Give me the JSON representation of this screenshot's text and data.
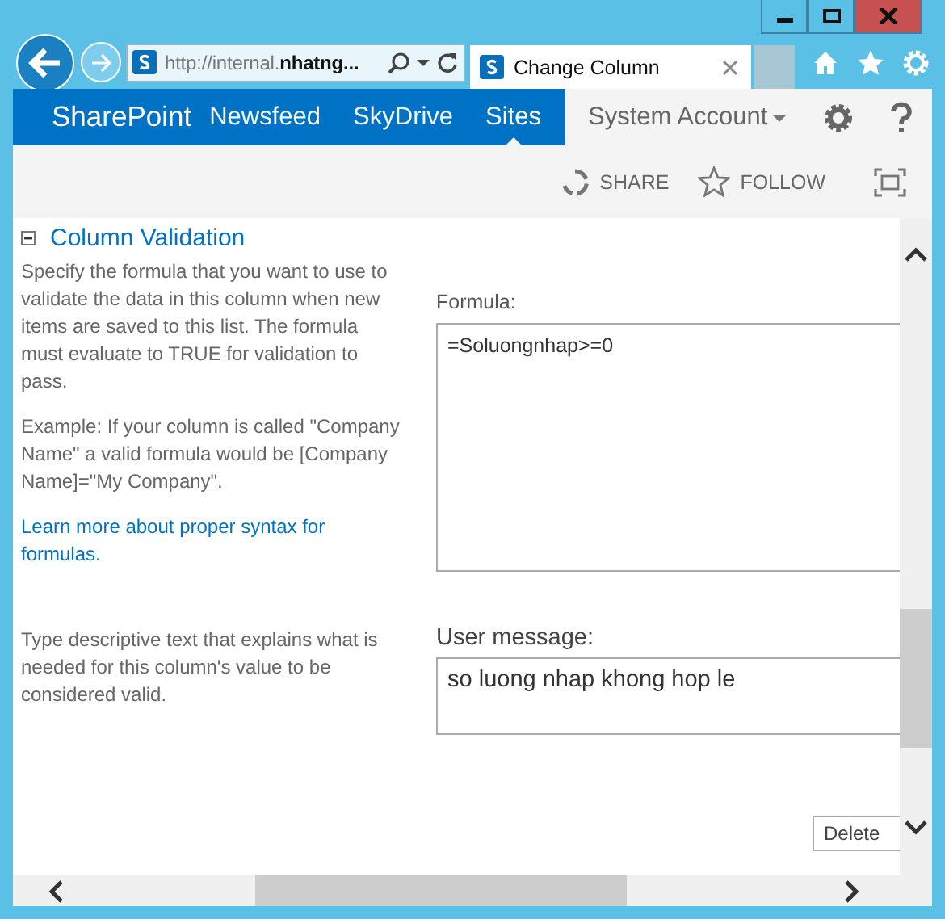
{
  "browser": {
    "address": "http://internal.**nhatng...**",
    "tab": {
      "title": "Change Column",
      "selected": true
    }
  },
  "suite_bar": {
    "brand": "SharePoint",
    "links": [
      {
        "label": "Newsfeed",
        "selected": false
      },
      {
        "label": "SkyDrive",
        "selected": false
      },
      {
        "label": "Sites",
        "selected": true
      }
    ],
    "account": "System Account"
  },
  "actions": [
    {
      "label": "SHARE",
      "kind": "share"
    },
    {
      "label": "FOLLOW",
      "kind": "follow"
    }
  ],
  "section": {
    "title": "Column Validation",
    "expanded": true,
    "description": "Specify the formula that you want to use to validate the data in this column when new items are saved to this list. The formula must evaluate to TRUE for validation to pass.",
    "example": "Example: If your column is called \"Company Name\" a valid formula would be [Company Name]=\"My Company\".",
    "link": "Learn more about proper syntax for formulas.",
    "message_help": "Type descriptive text that explains what is needed for this column's value to be considered valid."
  },
  "formula": {
    "label": "Formula:",
    "value": "=Soluongnhap>=0"
  },
  "user_message": {
    "label": "User message:",
    "value": "so luong nhap khong hop le"
  },
  "buttons": [
    "Delete"
  ]
}
